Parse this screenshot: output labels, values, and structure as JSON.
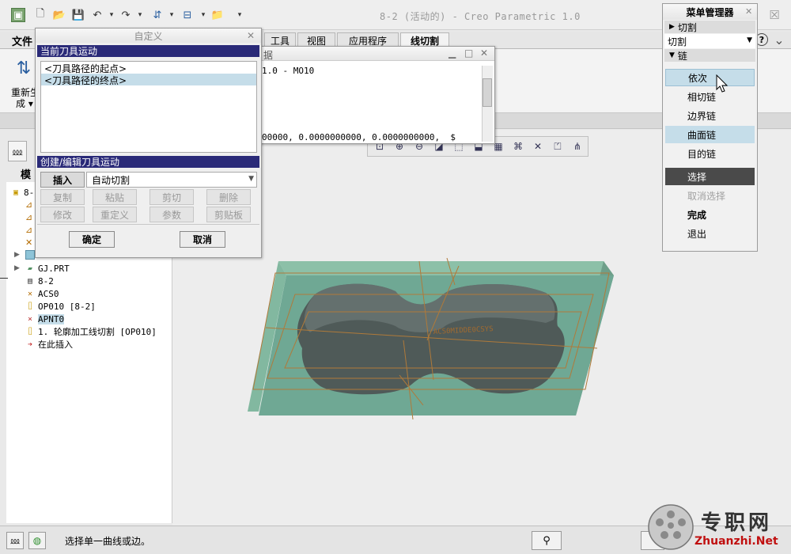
{
  "window": {
    "title": "8-2 (活动的) - Creo Parametric 1.0",
    "close_glyph": "☒"
  },
  "ribbon": {
    "file_tab": "文件",
    "tabs": [
      "工具",
      "视图",
      "应用程序",
      "线切割"
    ],
    "left_group_label_1": "重新生",
    "left_group_label_2": "成 ▾",
    "help_glyph": "?"
  },
  "model_tree": {
    "header_label": "模",
    "items": [
      {
        "label": "8-"
      },
      {
        "label": "GJ.PRT"
      },
      {
        "label": "8-2"
      },
      {
        "label": "ACS0"
      },
      {
        "label": "OP010 [8-2]"
      },
      {
        "label": "APNT0"
      },
      {
        "label": "1. 轮廓加工线切割 [OP010]"
      },
      {
        "label": "在此插入"
      }
    ]
  },
  "custom_dialog": {
    "title": "自定义",
    "section_current": "当前刀具运动",
    "list_items": [
      "<刀具路径的起点>",
      "<刀具路径的终点>"
    ],
    "section_edit": "创建/编辑刀具运动",
    "insert_label": "插入",
    "auto_cut_value": "自动切割",
    "buttons": [
      "复制",
      "粘贴",
      "剪切",
      "删除",
      "修改",
      "重定义",
      "参数",
      "剪贴板"
    ],
    "ok_label": "确定",
    "cancel_label": "取消"
  },
  "data_window": {
    "title_fragment": "据",
    "line_1": "1.0 - MO10",
    "line_2": "00000, 0.0000000000, 0.0000000000,  $"
  },
  "menu_manager": {
    "title": "菜单管理器",
    "section_cut": "切割",
    "cut_select_value": "切割",
    "section_chain": "链",
    "chain_items": [
      "依次",
      "相切链",
      "边界链",
      "曲面链",
      "目的链"
    ],
    "select_label": "选择",
    "deselect_label": "取消选择",
    "done_label": "完成",
    "exit_label": "退出"
  },
  "model_labels": {
    "csys_text": "ACS0MIDDE0CSYS"
  },
  "status": {
    "message": "选择单一曲线或边。",
    "watermark_cn": "专职网",
    "watermark_url": "Zhuanzhi.Net"
  },
  "colors": {
    "section_header": "#2a2a78",
    "selection_highlight": "#c5dde9",
    "menu_selected": "#4a4a4a",
    "plate": "#6fa894",
    "part": "#4f5a58",
    "toolpath": "#b07a3a"
  }
}
